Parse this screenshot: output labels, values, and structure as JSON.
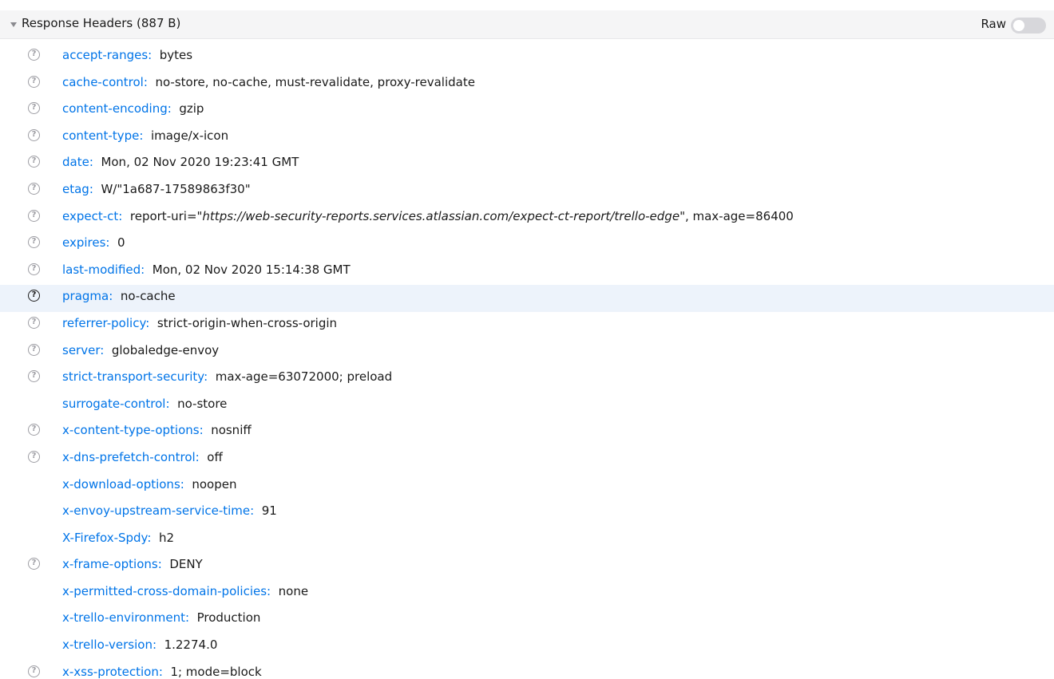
{
  "header": {
    "title": "Response Headers (887 B)",
    "raw_label": "Raw",
    "raw_enabled": false
  },
  "rows": [
    {
      "name": "accept-ranges:",
      "value": "bytes",
      "help": true
    },
    {
      "name": "cache-control:",
      "value": "no-store, no-cache, must-revalidate, proxy-revalidate",
      "help": true
    },
    {
      "name": "content-encoding:",
      "value": "gzip",
      "help": true
    },
    {
      "name": "content-type:",
      "value": "image/x-icon",
      "help": true
    },
    {
      "name": "date:",
      "value": "Mon, 02 Nov 2020 19:23:41 GMT",
      "help": true
    },
    {
      "name": "etag:",
      "value": "W/\"1a687-17589863f30\"",
      "help": true
    },
    {
      "name": "expect-ct:",
      "value_pre": "report-uri=\"",
      "value_url": "https://web-security-reports.services.atlassian.com/expect-ct-report/trello-edge",
      "value_post": "\", max-age=86400",
      "help": true
    },
    {
      "name": "expires:",
      "value": "0",
      "help": true
    },
    {
      "name": "last-modified:",
      "value": "Mon, 02 Nov 2020 15:14:38 GMT",
      "help": true
    },
    {
      "name": "pragma:",
      "value": "no-cache",
      "help": true,
      "highlighted": true
    },
    {
      "name": "referrer-policy:",
      "value": "strict-origin-when-cross-origin",
      "help": true
    },
    {
      "name": "server:",
      "value": "globaledge-envoy",
      "help": true
    },
    {
      "name": "strict-transport-security:",
      "value": "max-age=63072000; preload",
      "help": true
    },
    {
      "name": "surrogate-control:",
      "value": "no-store",
      "help": false
    },
    {
      "name": "x-content-type-options:",
      "value": "nosniff",
      "help": true
    },
    {
      "name": "x-dns-prefetch-control:",
      "value": "off",
      "help": true
    },
    {
      "name": "x-download-options:",
      "value": "noopen",
      "help": false
    },
    {
      "name": "x-envoy-upstream-service-time:",
      "value": "91",
      "help": false
    },
    {
      "name": "X-Firefox-Spdy:",
      "value": "h2",
      "help": false
    },
    {
      "name": "x-frame-options:",
      "value": "DENY",
      "help": true
    },
    {
      "name": "x-permitted-cross-domain-policies:",
      "value": "none",
      "help": false
    },
    {
      "name": "x-trello-environment:",
      "value": "Production",
      "help": false
    },
    {
      "name": "x-trello-version:",
      "value": "1.2274.0",
      "help": false
    },
    {
      "name": "x-xss-protection:",
      "value": "1; mode=block",
      "help": true
    }
  ],
  "icons": {
    "help_glyph": "?",
    "twisty": "chevron-down-icon"
  },
  "colors": {
    "header_name": "#0074e8",
    "highlight_row": "#edf3fb"
  }
}
